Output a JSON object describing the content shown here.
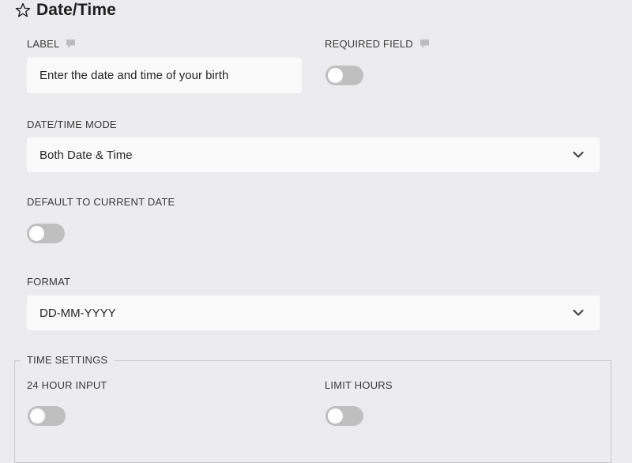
{
  "header": {
    "title": "Date/Time",
    "icon": "star-outline-icon"
  },
  "fields": {
    "label": {
      "label": "LABEL",
      "value": "Enter the date and time of your birth"
    },
    "required": {
      "label": "REQUIRED FIELD",
      "checked": false
    },
    "mode": {
      "label": "DATE/TIME MODE",
      "selected": "Both Date & Time"
    },
    "default_current": {
      "label": "DEFAULT TO CURRENT DATE",
      "checked": false
    },
    "format": {
      "label": "FORMAT",
      "selected": "DD-MM-YYYY"
    }
  },
  "time_settings": {
    "legend": "TIME SETTINGS",
    "hour24": {
      "label": "24 HOUR INPUT",
      "checked": false
    },
    "limit_hours": {
      "label": "LIMIT HOURS",
      "checked": false
    }
  },
  "colors": {
    "background": "#ececee",
    "field_bg": "#fafafa",
    "toggle_off": "#bfbfbf"
  }
}
